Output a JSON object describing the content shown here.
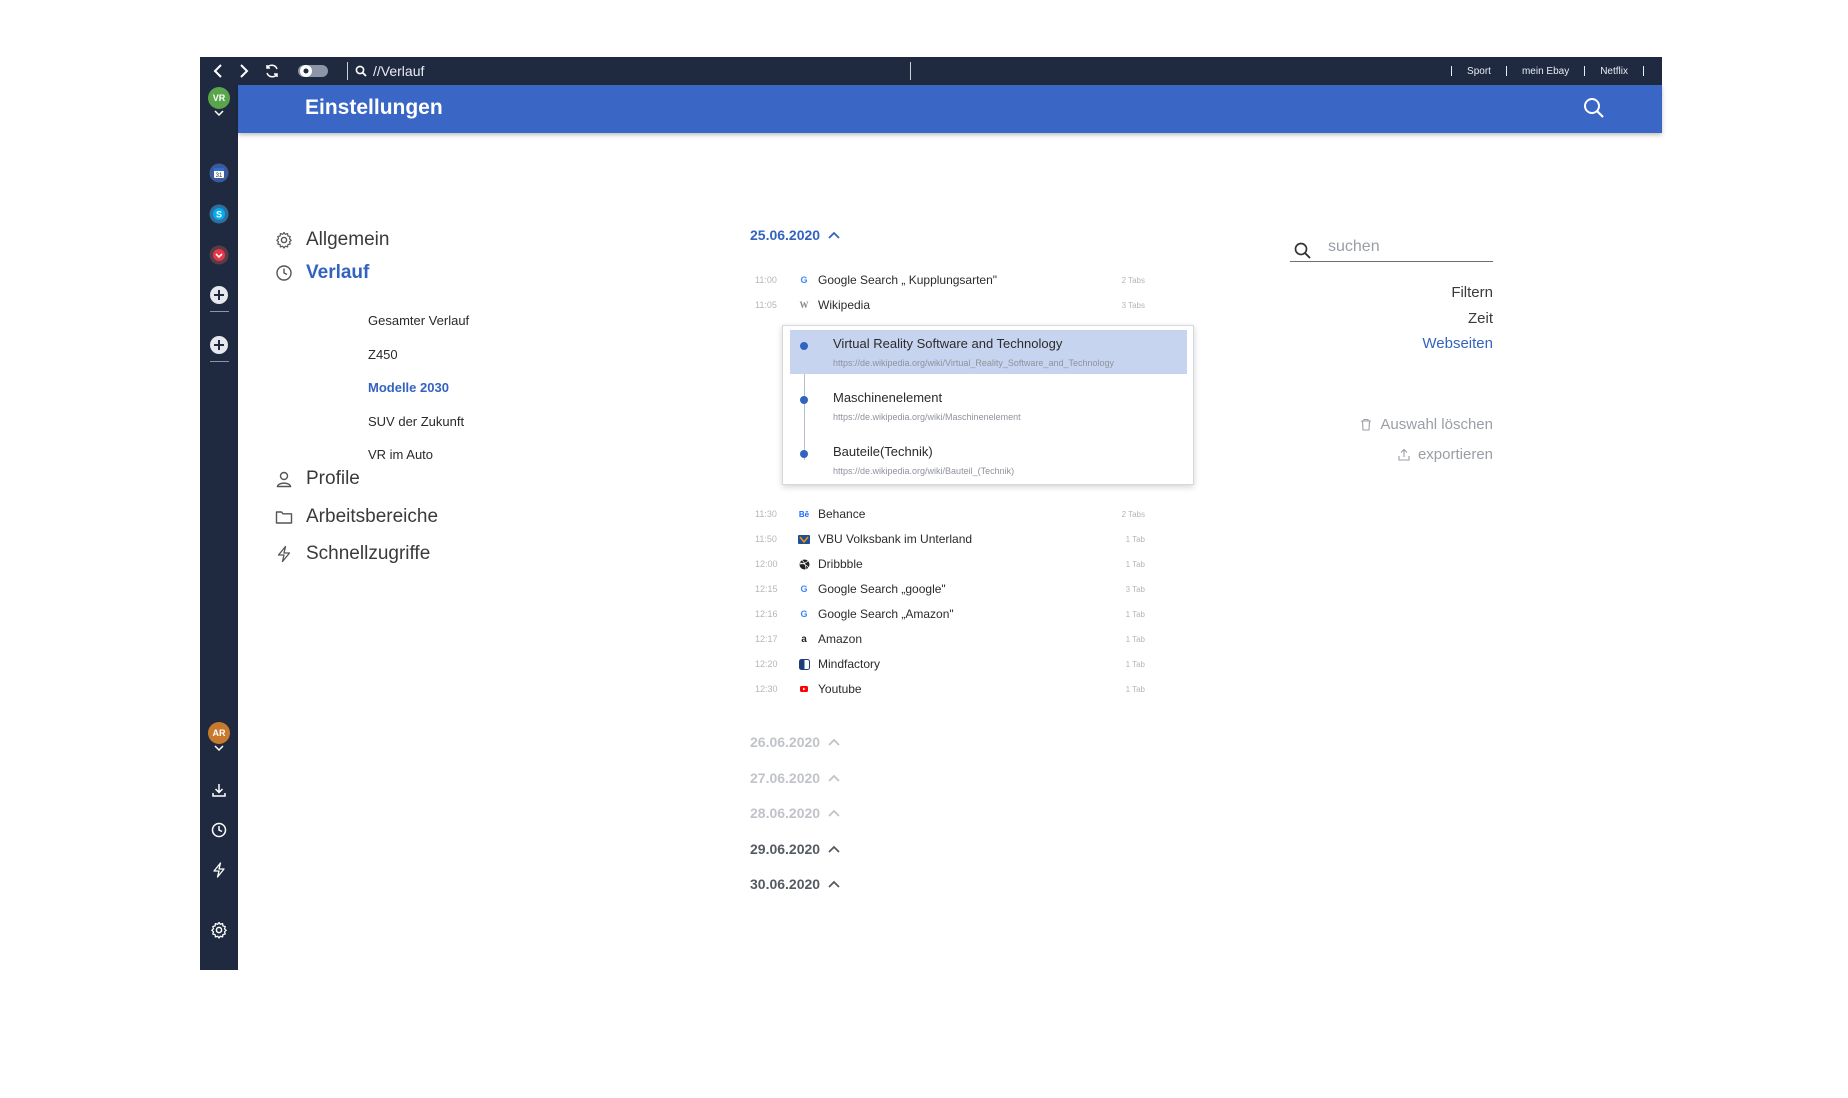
{
  "browser": {
    "address": "//Verlauf",
    "bookmarks": [
      "Sport",
      "mein Ebay",
      "Netflix"
    ]
  },
  "rail": {
    "user_initials": "VR",
    "user_color": "#5aa54a",
    "second_user_initials": "AR",
    "second_user_color": "#c77a2e"
  },
  "header": {
    "title": "Einstellungen"
  },
  "settings_nav": {
    "items": [
      "Allgemein",
      "Verlauf",
      "Profile",
      "Arbeitsbereiche",
      "Schnellzugriffe"
    ],
    "verlauf_sub": [
      "Gesamter Verlauf",
      "Z450",
      "Modelle 2030",
      "SUV der Zukunft",
      "VR im Auto"
    ]
  },
  "history": {
    "current_date": "25.06.2020",
    "entries_before": [
      {
        "time": "11:00",
        "name": "Google  Search „ Kupplungsarten\"",
        "tabs": "2 Tabs",
        "icon": "google-icon"
      },
      {
        "time": "11:05",
        "name": "Wikipedia",
        "tabs": "3 Tabs",
        "icon": "wikipedia-icon"
      }
    ],
    "popup": [
      {
        "title": "Virtual Reality Software and Technology",
        "url": "https://de.wikipedia.org/wiki/Virtual_Reality_Software_and_Technology"
      },
      {
        "title": "Maschinenelement",
        "url": "https://de.wikipedia.org/wiki/Maschinenelement"
      },
      {
        "title": "Bauteile(Technik)",
        "url": "https://de.wikipedia.org/wiki/Bauteil_(Technik)"
      }
    ],
    "entries_after": [
      {
        "time": "11:30",
        "name": "Behance",
        "tabs": "2 Tabs",
        "icon": "behance-icon"
      },
      {
        "time": "11:50",
        "name": "VBU Volksbank im Unterland",
        "tabs": "1 Tab",
        "icon": "volksbank-icon"
      },
      {
        "time": "12:00",
        "name": "Dribbble",
        "tabs": "1 Tab",
        "icon": "dribbble-icon"
      },
      {
        "time": "12:15",
        "name": "Google Search „google\"",
        "tabs": "3 Tab",
        "icon": "google-icon"
      },
      {
        "time": "12:16",
        "name": "Google Search „Amazon\"",
        "tabs": "1 Tab",
        "icon": "google-icon"
      },
      {
        "time": "12:17",
        "name": "Amazon",
        "tabs": "1 Tab",
        "icon": "amazon-icon"
      },
      {
        "time": "12:20",
        "name": "Mindfactory",
        "tabs": "1 Tab",
        "icon": "mindfactory-icon"
      },
      {
        "time": "12:30",
        "name": "Youtube",
        "tabs": "1 Tab",
        "icon": "youtube-icon"
      }
    ],
    "other_dates": [
      "26.06.2020",
      "27.06.2020",
      "28.06.2020",
      "29.06.2020",
      "30.06.2020"
    ]
  },
  "right_panel": {
    "search_placeholder": "suchen",
    "filter_label": "Filtern",
    "time_label": "Zeit",
    "websites_label": "Webseiten",
    "clear_label": "Auswahl löschen",
    "export_label": "exportieren"
  },
  "colors": {
    "accent": "#3363c0",
    "header": "#3a66c6",
    "chrome": "#1f2a40"
  }
}
